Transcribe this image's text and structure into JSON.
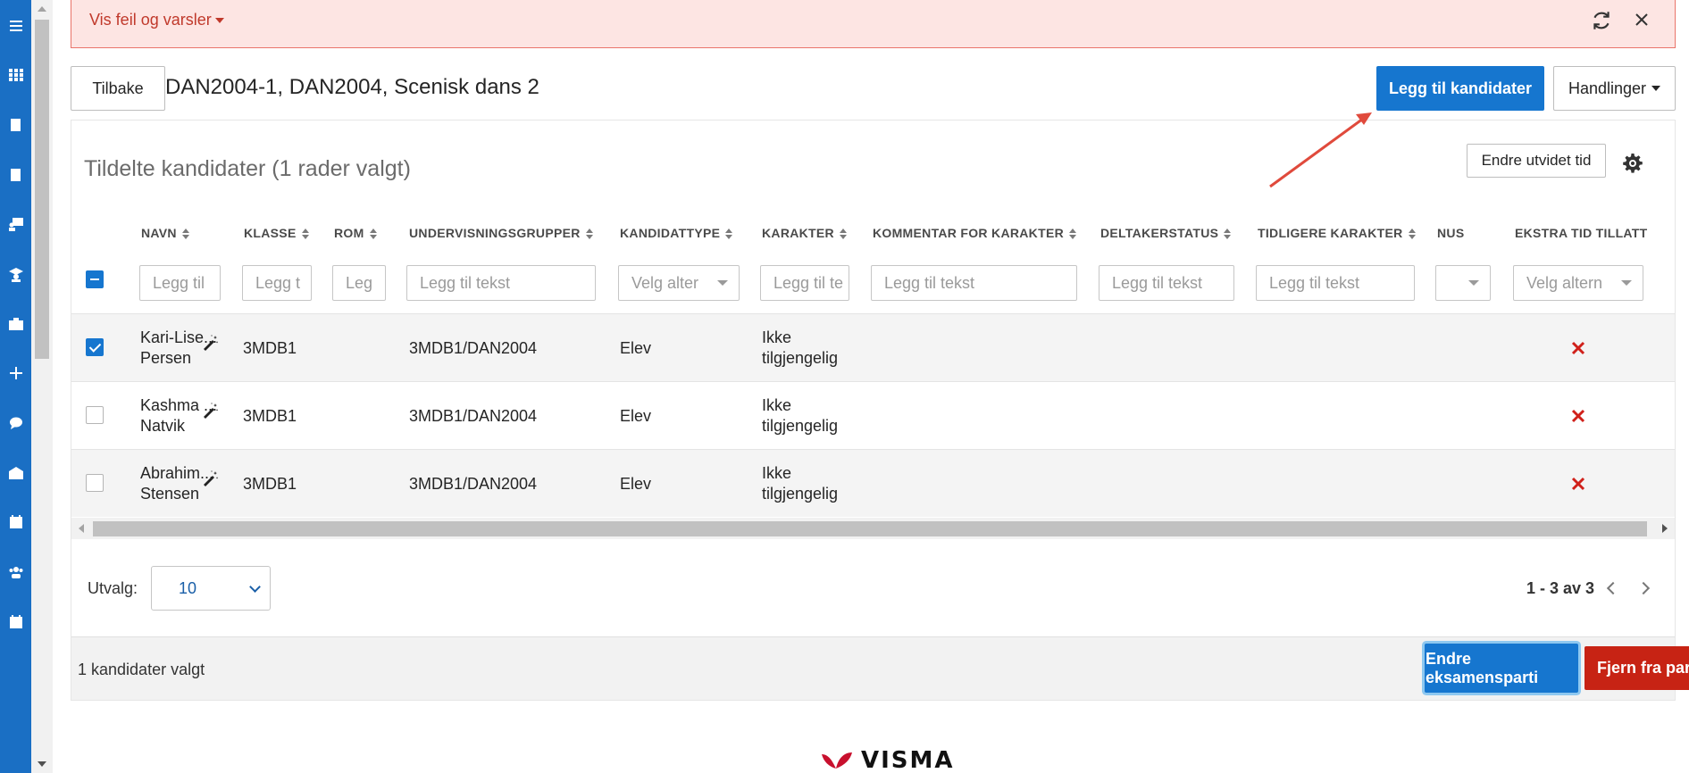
{
  "banner": {
    "toggle_label": "Vis feil og varsler"
  },
  "header": {
    "back_label": "Tilbake",
    "title": "DAN2004-1, DAN2004, Scenisk dans 2",
    "add_candidates_label": "Legg til kandidater",
    "actions_label": "Handlinger"
  },
  "card": {
    "title": "Tildelte kandidater (1 rader valgt)",
    "extend_time_label": "Endre utvidet tid"
  },
  "table": {
    "columns": [
      "NAVN",
      "KLASSE",
      "ROM",
      "UNDERVISNINGSGRUPPER",
      "KANDIDATTYPE",
      "KARAKTER",
      "KOMMENTAR FOR KARAKTER",
      "DELTAKERSTATUS",
      "TIDLIGERE KARAKTER",
      "NUS",
      "EKSTRA TID TILLATT"
    ],
    "filters": [
      "Legg til",
      "Legg t",
      "Leg",
      "Legg til tekst",
      "Velg alter",
      "Legg til te",
      "Legg til tekst",
      "Legg til tekst",
      "Legg til tekst",
      "",
      "Velg altern"
    ],
    "rows": [
      {
        "checked": true,
        "name_line1": "Kari-Lise...",
        "name_line2": "Persen",
        "klasse": "3MDB1",
        "gruppe": "3MDB1/DAN2004",
        "type": "Elev",
        "karakter_line1": "Ikke",
        "karakter_line2": "tilgjengelig"
      },
      {
        "checked": false,
        "name_line1": "Kashma ...",
        "name_line2": "Natvik",
        "klasse": "3MDB1",
        "gruppe": "3MDB1/DAN2004",
        "type": "Elev",
        "karakter_line1": "Ikke",
        "karakter_line2": "tilgjengelig"
      },
      {
        "checked": false,
        "name_line1": "Abrahim...",
        "name_line2": "Stensen",
        "klasse": "3MDB1",
        "gruppe": "3MDB1/DAN2004",
        "type": "Elev",
        "karakter_line1": "Ikke",
        "karakter_line2": "tilgjengelig"
      }
    ]
  },
  "pagination": {
    "utvalg_label": "Utvalg:",
    "page_size": "10",
    "range_text": "1 - 3 av 3"
  },
  "footer": {
    "selected_text": "1 kandidater valgt",
    "change_party_label": "Endre eksamensparti",
    "remove_label": "Fjern fra parti"
  },
  "logo": {
    "text": "VISMA"
  },
  "colors": {
    "primary": "#1676cf",
    "danger": "#c72314",
    "nav": "#1a6fc4",
    "banner_bg": "#fde5e3"
  }
}
